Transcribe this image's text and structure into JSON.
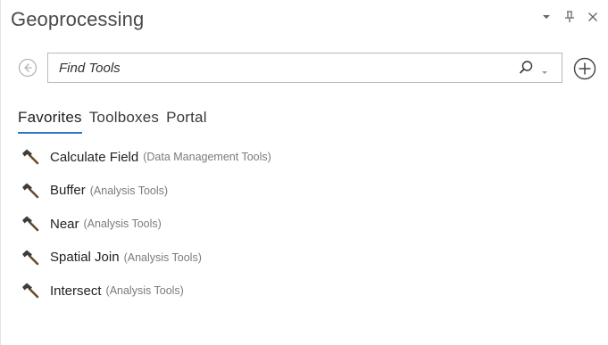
{
  "pane": {
    "title": "Geoprocessing",
    "controls": {
      "options_icon": "dropdown-arrow-icon",
      "pin_icon": "pin-icon",
      "close_icon": "close-icon"
    }
  },
  "search": {
    "placeholder": "Find Tools",
    "value": "",
    "back_icon": "back-arrow-icon",
    "search_icon": "search-icon",
    "options_icon": "dropdown-arrow-icon",
    "add_icon": "add-circle-icon"
  },
  "tabs": [
    {
      "label": "Favorites",
      "active": true
    },
    {
      "label": "Toolboxes",
      "active": false
    },
    {
      "label": "Portal",
      "active": false
    }
  ],
  "tools": [
    {
      "name": "Calculate Field",
      "toolbox": "(Data Management Tools)",
      "icon": "hammer-icon"
    },
    {
      "name": "Buffer",
      "toolbox": "(Analysis Tools)",
      "icon": "hammer-icon"
    },
    {
      "name": "Near",
      "toolbox": "(Analysis Tools)",
      "icon": "hammer-icon"
    },
    {
      "name": "Spatial Join",
      "toolbox": "(Analysis Tools)",
      "icon": "hammer-icon"
    },
    {
      "name": "Intersect",
      "toolbox": "(Analysis Tools)",
      "icon": "hammer-icon"
    }
  ],
  "colors": {
    "accent": "#2e76c5",
    "secondary_text": "#7b7b7b"
  }
}
